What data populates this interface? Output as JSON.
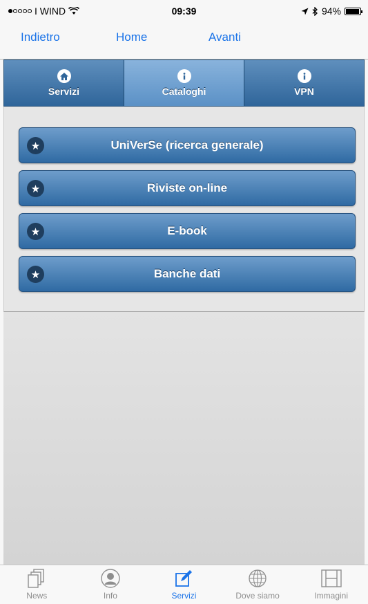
{
  "status_bar": {
    "carrier": "I WIND",
    "time": "09:39",
    "battery": "94%",
    "battery_level": 0.94
  },
  "nav": {
    "back": "Indietro",
    "home": "Home",
    "forward": "Avanti"
  },
  "tabs": [
    {
      "label": "Servizi",
      "icon": "home-icon"
    },
    {
      "label": "Cataloghi",
      "icon": "info-icon",
      "active": true
    },
    {
      "label": "VPN",
      "icon": "info-icon"
    }
  ],
  "items": [
    {
      "label": "UniVerSe (ricerca generale)",
      "icon": "star-icon"
    },
    {
      "label": "Riviste on-line",
      "icon": "star-icon"
    },
    {
      "label": "E-book",
      "icon": "star-icon"
    },
    {
      "label": "Banche dati",
      "icon": "star-icon"
    }
  ],
  "bottom_tabs": [
    {
      "label": "News",
      "icon": "news-icon"
    },
    {
      "label": "Info",
      "icon": "person-icon"
    },
    {
      "label": "Servizi",
      "icon": "compose-icon",
      "active": true
    },
    {
      "label": "Dove siamo",
      "icon": "globe-icon"
    },
    {
      "label": "Immagini",
      "icon": "film-icon"
    }
  ],
  "colors": {
    "accent": "#1a73e8",
    "tab_gradient_top": "#5f8fbd",
    "tab_gradient_bottom": "#2f659a",
    "active_tab": "#89b3dc",
    "button_top": "#6e9dcb",
    "button_bottom": "#2f6aa3"
  }
}
